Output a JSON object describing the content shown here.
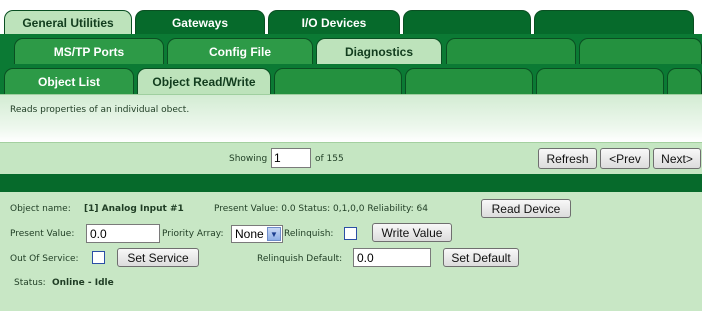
{
  "tabs_row1": [
    "General Utilities",
    "Gateways",
    "I/O Devices",
    "",
    ""
  ],
  "tabs_row2": [
    "MS/TP Ports",
    "Config File",
    "Diagnostics",
    "",
    ""
  ],
  "tabs_row3": [
    "Object List",
    "Object Read/Write",
    "",
    "",
    "",
    ""
  ],
  "description": "Reads properties of an individual obect.",
  "nav": {
    "showing_label": "Showing",
    "page_value": "1",
    "of_label": "of 155",
    "refresh": "Refresh",
    "prev": "<Prev",
    "next": "Next>"
  },
  "object": {
    "name_label": "Object name:",
    "name_value": "[1] Analog Input #1",
    "present_value_text": "Present Value: 0.0 Status: 0,1,0,0 Reliability: 64",
    "read_device": "Read Device",
    "present_value_label": "Present Value:",
    "present_value_input": "0.0",
    "priority_label": "Priority Array:",
    "priority_selected": "None",
    "relinquish_label": "Relinquish:",
    "write_value": "Write Value",
    "out_of_service_label": "Out Of Service:",
    "set_service": "Set Service",
    "relinquish_default_label": "Relinquish Default:",
    "relinquish_default_value": "0.0",
    "set_default": "Set Default",
    "status_label": "Status:",
    "status_value": "Online - Idle"
  }
}
